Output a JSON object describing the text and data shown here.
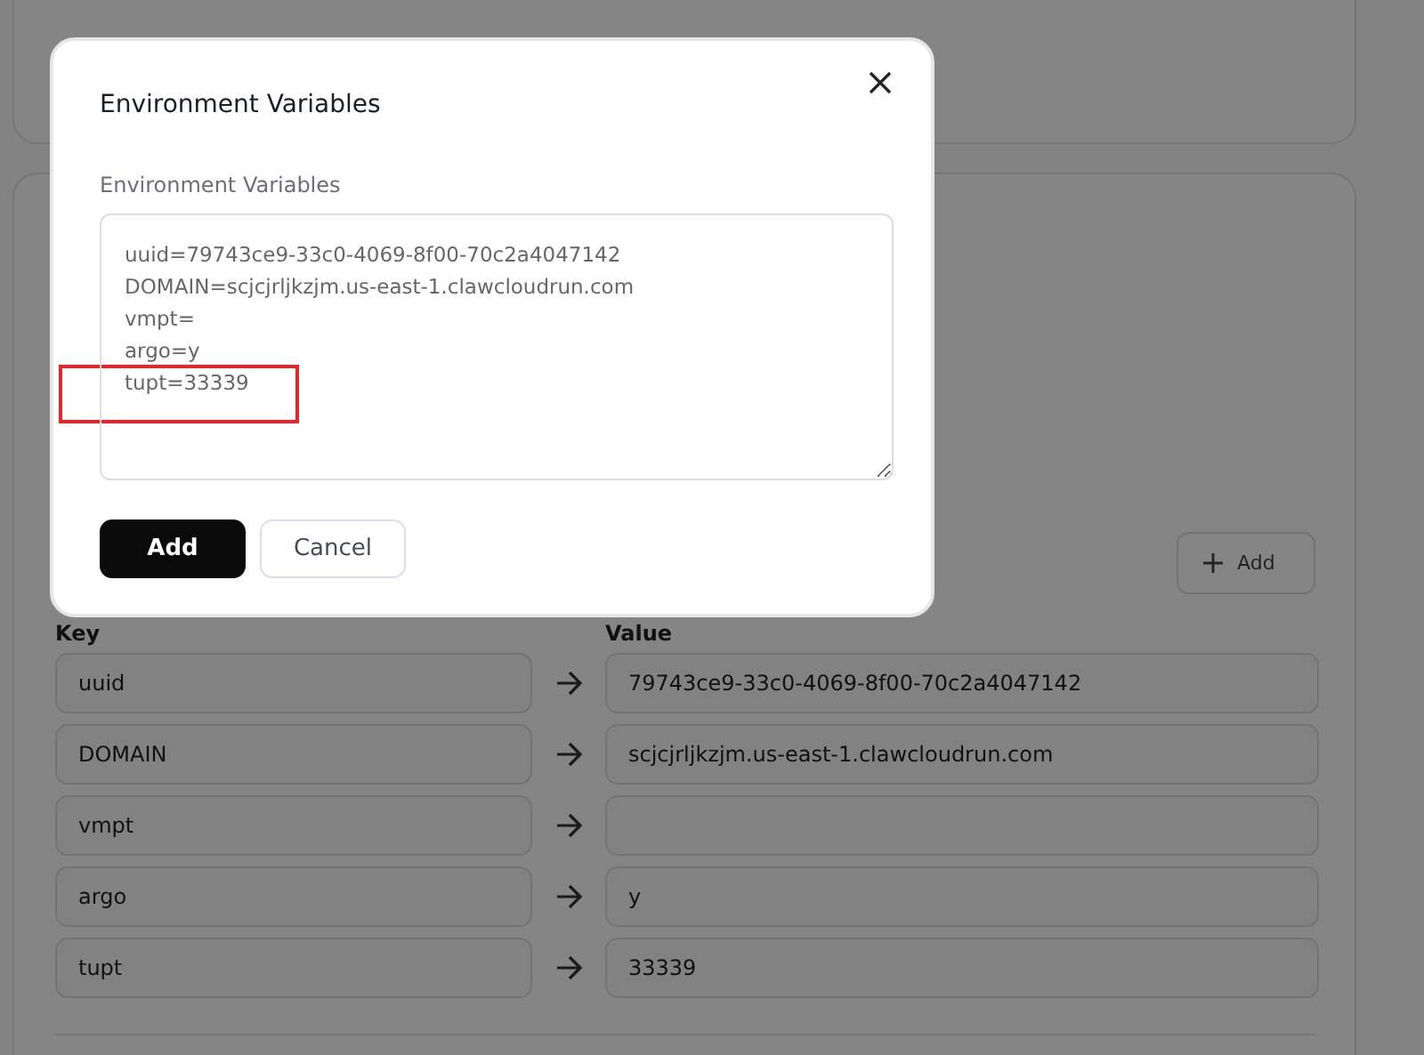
{
  "dialog": {
    "title": "Environment Variables",
    "field_label": "Environment Variables",
    "text_lines": [
      "uuid=79743ce9-33c0-4069-8f00-70c2a4047142",
      "DOMAIN=scjcjrljkzjm.us-east-1.clawcloudrun.com",
      "vmpt=",
      "argo=y",
      "tupt=33339"
    ],
    "buttons": [
      {
        "label": "Add",
        "kind": "primary"
      },
      {
        "label": "Cancel",
        "kind": "secondary"
      }
    ]
  },
  "env_panel": {
    "add_button": "Add",
    "columns": [
      "Key",
      "Value"
    ],
    "rows": [
      {
        "key": "uuid",
        "value": "79743ce9-33c0-4069-8f00-70c2a4047142"
      },
      {
        "key": "DOMAIN",
        "value": "scjcjrljkzjm.us-east-1.clawcloudrun.com"
      },
      {
        "key": "vmpt",
        "value": ""
      },
      {
        "key": "argo",
        "value": "y"
      },
      {
        "key": "tupt",
        "value": "33339"
      }
    ]
  }
}
